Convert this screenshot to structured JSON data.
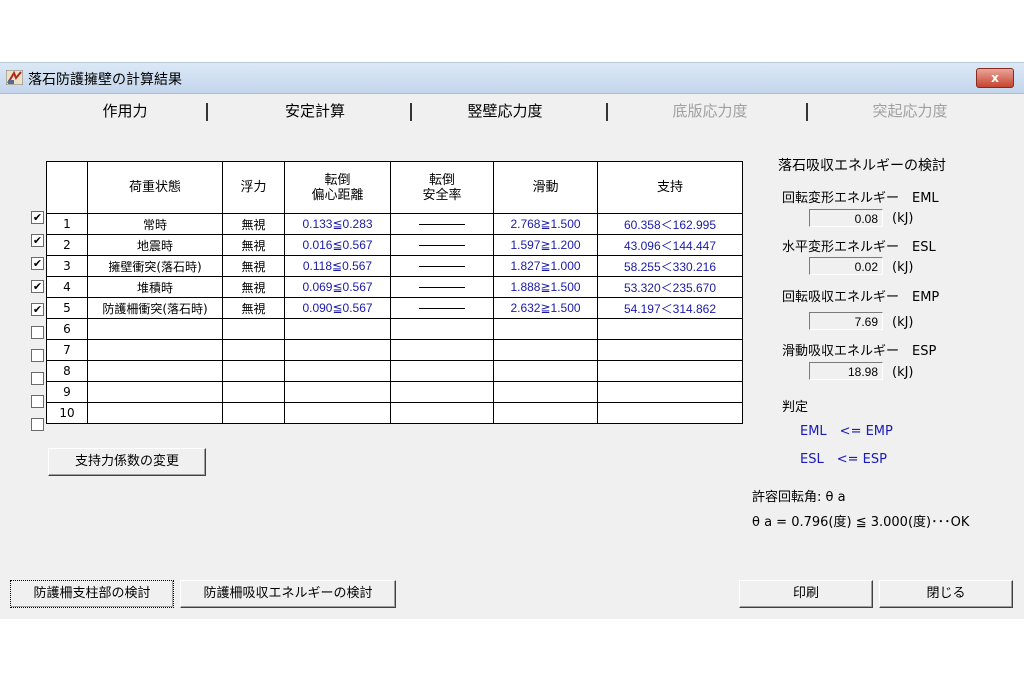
{
  "window": {
    "title": "落石防護擁壁の計算結果",
    "close_label": "x"
  },
  "tabs": [
    {
      "label": "作用力",
      "disabled": false
    },
    {
      "label": "安定計算",
      "disabled": false
    },
    {
      "label": "竪壁応力度",
      "disabled": false
    },
    {
      "label": "底版応力度",
      "disabled": true
    },
    {
      "label": "突起応力度",
      "disabled": true
    }
  ],
  "table": {
    "headers": {
      "load_state": "荷重状態",
      "buoyancy": "浮力",
      "overturn_ecc_1": "転倒",
      "overturn_ecc_2": "偏心距離",
      "overturn_sf_1": "転倒",
      "overturn_sf_2": "安全率",
      "sliding": "滑動",
      "bearing": "支持"
    },
    "rows": [
      {
        "checked": true,
        "no": "1",
        "state": "常時",
        "buoyancy": "無視",
        "ecc": "0.133≦0.283",
        "sf": "dash",
        "slide": "2.768≧1.500",
        "bearing": "60.358＜162.995"
      },
      {
        "checked": true,
        "no": "2",
        "state": "地震時",
        "buoyancy": "無視",
        "ecc": "0.016≦0.567",
        "sf": "dash",
        "slide": "1.597≧1.200",
        "bearing": "43.096＜144.447"
      },
      {
        "checked": true,
        "no": "3",
        "state": "擁壁衝突(落石時)",
        "buoyancy": "無視",
        "ecc": "0.118≦0.567",
        "sf": "dash",
        "slide": "1.827≧1.000",
        "bearing": "58.255＜330.216"
      },
      {
        "checked": true,
        "no": "4",
        "state": "堆積時",
        "buoyancy": "無視",
        "ecc": "0.069≦0.567",
        "sf": "dash",
        "slide": "1.888≧1.500",
        "bearing": "53.320＜235.670"
      },
      {
        "checked": true,
        "no": "5",
        "state": "防護柵衝突(落石時)",
        "buoyancy": "無視",
        "ecc": "0.090≦0.567",
        "sf": "dash",
        "slide": "2.632≧1.500",
        "bearing": "54.197＜314.862"
      },
      {
        "checked": false,
        "no": "6",
        "state": "",
        "buoyancy": "",
        "ecc": "",
        "sf": "",
        "slide": "",
        "bearing": ""
      },
      {
        "checked": false,
        "no": "7",
        "state": "",
        "buoyancy": "",
        "ecc": "",
        "sf": "",
        "slide": "",
        "bearing": ""
      },
      {
        "checked": false,
        "no": "8",
        "state": "",
        "buoyancy": "",
        "ecc": "",
        "sf": "",
        "slide": "",
        "bearing": ""
      },
      {
        "checked": false,
        "no": "9",
        "state": "",
        "buoyancy": "",
        "ecc": "",
        "sf": "",
        "slide": "",
        "bearing": ""
      },
      {
        "checked": false,
        "no": "10",
        "state": "",
        "buoyancy": "",
        "ecc": "",
        "sf": "",
        "slide": "",
        "bearing": ""
      }
    ]
  },
  "energy": {
    "title": "落石吸収エネルギーの検討",
    "eml_label": "回転変形エネルギー　EML",
    "eml_value": "0.08",
    "esl_label": "水平変形エネルギー　ESL",
    "esl_value": "0.02",
    "emp_label": "回転吸収エネルギー　EMP",
    "emp_value": "7.69",
    "esp_label": "滑動吸収エネルギー　ESP",
    "esp_value": "18.98",
    "unit": "(kJ)",
    "judge_label": "判定",
    "judge_1": "EML　<= EMP",
    "judge_2": "ESL　<= ESP",
    "rotation_label": "許容回転角: θ a",
    "rotation_value": "θ a = 0.796(度) ≦ 3.000(度)･･･OK"
  },
  "buttons": {
    "bearing_coef": "支持力係数の変更",
    "fence_support": "防護柵支柱部の検討",
    "fence_energy": "防護柵吸収エネルギーの検討",
    "print": "印刷",
    "close": "閉じる"
  },
  "colors": {
    "accent_blue": "#1a1aa8",
    "titlebar": "#c4d6ec",
    "close_red": "#c7442f"
  }
}
